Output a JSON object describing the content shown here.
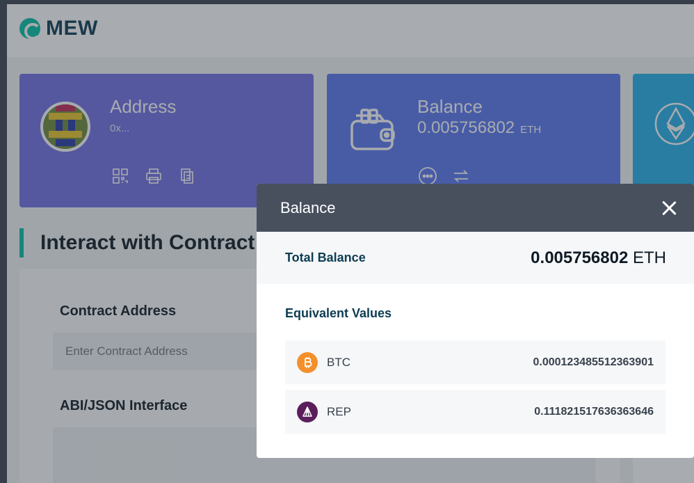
{
  "brand": {
    "name": "MEW"
  },
  "cards": {
    "address": {
      "title": "Address",
      "value": "0x..."
    },
    "balance": {
      "title": "Balance",
      "amount": "0.005756802",
      "unit": "ETH"
    }
  },
  "main": {
    "section_title": "Interact with Contract",
    "contract_address_label": "Contract Address",
    "contract_address_placeholder": "Enter Contract Address",
    "abi_label": "ABI/JSON Interface"
  },
  "modal": {
    "title": "Balance",
    "total_label": "Total Balance",
    "total_amount": "0.005756802",
    "total_unit": "ETH",
    "equiv_label": "Equivalent Values",
    "coins": [
      {
        "symbol": "BTC",
        "value": "0.000123485512363901",
        "color": "#f4902c",
        "icon": "bitcoin-icon"
      },
      {
        "symbol": "REP",
        "value": "0.111821517636363646",
        "color": "#5b1e5c",
        "icon": "augur-icon"
      }
    ]
  },
  "colors": {
    "address_card": "#7070e3",
    "balance_card": "#5a78f0",
    "network_card": "#25b0e8",
    "accent": "#05c0a5",
    "modal_header": "#48505e"
  }
}
